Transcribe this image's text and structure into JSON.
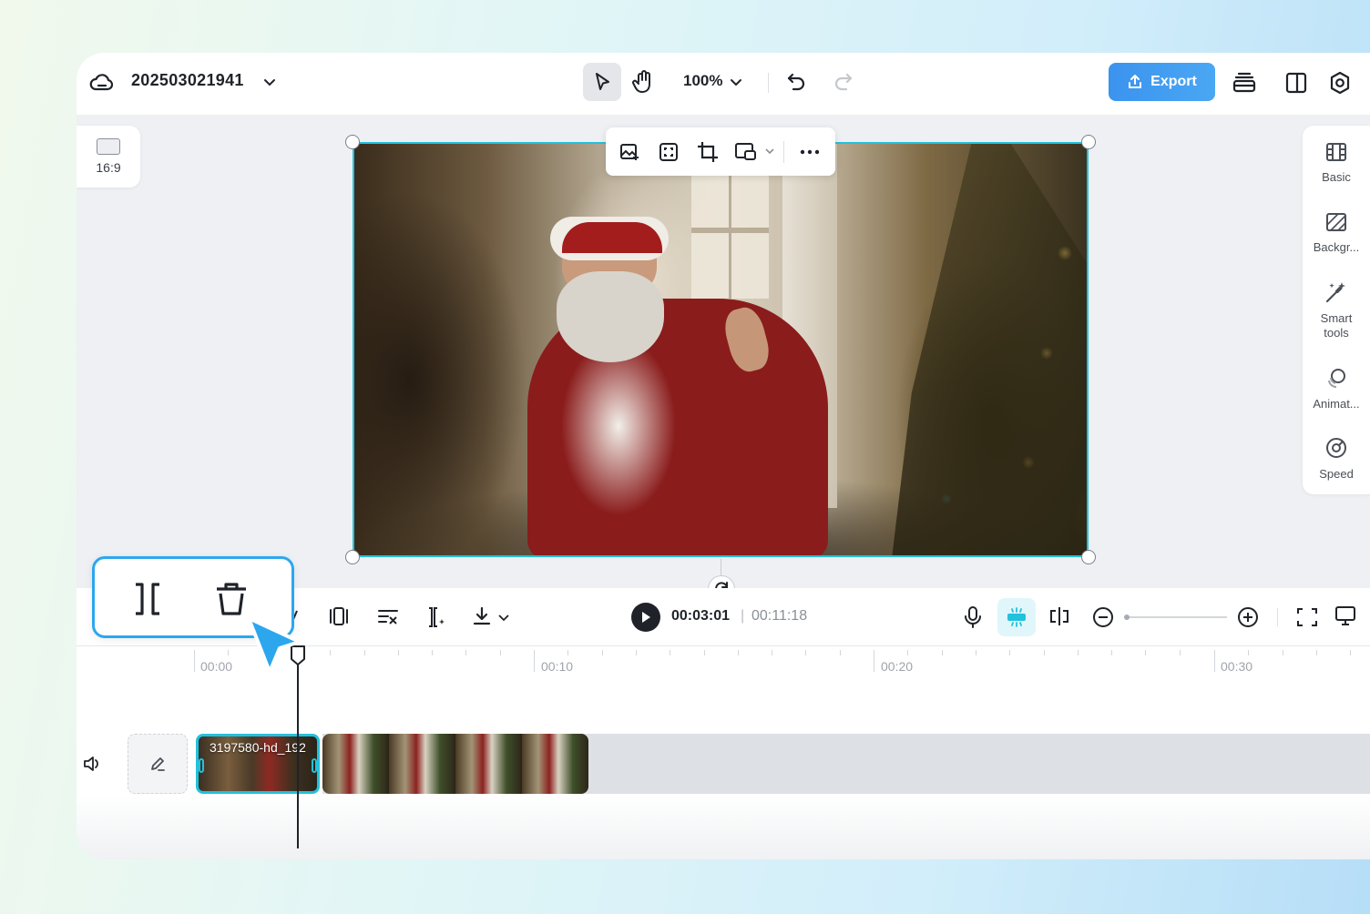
{
  "topbar": {
    "project_name": "202503021941",
    "zoom": "100%",
    "export_label": "Export"
  },
  "canvas": {
    "aspect_ratio": "16:9"
  },
  "right_panel": {
    "items": [
      {
        "label": "Basic",
        "icon": "film-icon"
      },
      {
        "label": "Backgr...",
        "icon": "background-icon"
      },
      {
        "label": "Smart\ntools",
        "icon": "magic-wand-icon"
      },
      {
        "label": "Animat...",
        "icon": "animation-icon"
      },
      {
        "label": "Speed",
        "icon": "speed-icon"
      }
    ]
  },
  "timeline": {
    "current_time": "00:03:01",
    "separator": "|",
    "total_time": "00:11:18",
    "ruler": [
      "00:00",
      "00:10",
      "00:20",
      "00:30"
    ],
    "clip_label": "3197580-hd_192"
  },
  "colors": {
    "accent": "#22c1dc",
    "export": "#3b93ee",
    "callout_border": "#2ca7ee"
  }
}
